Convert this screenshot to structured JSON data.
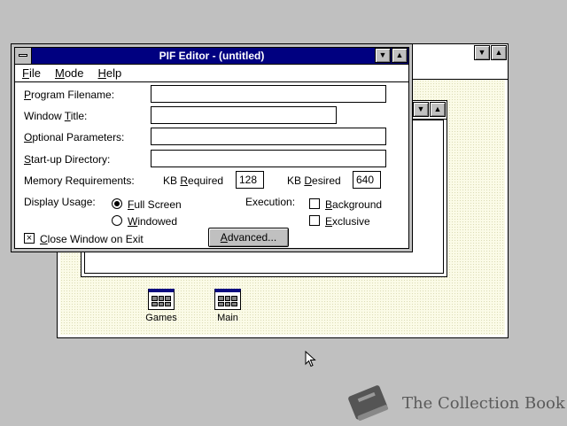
{
  "pif_editor": {
    "title": "PIF Editor - (untitled)",
    "menu": [
      {
        "key": "F",
        "rest": "ile"
      },
      {
        "key": "M",
        "rest": "ode"
      },
      {
        "key": "H",
        "rest": "elp"
      }
    ],
    "program_filename": {
      "key": "P",
      "rest": "rogram Filename:",
      "value": ""
    },
    "window_title": {
      "pre": "Window ",
      "key": "T",
      "rest": "itle:",
      "value": ""
    },
    "optional_parameters": {
      "key": "O",
      "rest": "ptional Parameters:",
      "value": ""
    },
    "startup_directory": {
      "key": "S",
      "rest": "tart-up Directory:",
      "value": ""
    },
    "memory": {
      "label": "Memory Requirements:",
      "kb_required": {
        "pre": "KB ",
        "key": "R",
        "rest": "equired",
        "value": "128"
      },
      "kb_desired": {
        "pre": "KB ",
        "key": "D",
        "rest": "esired",
        "value": "640"
      }
    },
    "display_usage": {
      "label": "Display Usage:",
      "full_screen": {
        "key": "F",
        "rest": "ull Screen",
        "selected": true
      },
      "windowed": {
        "key": "W",
        "rest": "indowed",
        "selected": false
      }
    },
    "execution": {
      "label": "Execution:",
      "background": {
        "key": "B",
        "rest": "ackground",
        "checked": false
      },
      "exclusive": {
        "key": "E",
        "rest": "xclusive",
        "checked": false
      }
    },
    "close_on_exit": {
      "key": "C",
      "rest": "lose Window on Exit",
      "checked": true,
      "mark": "×"
    },
    "advanced_button": {
      "key": "A",
      "rest": "dvanced..."
    }
  },
  "desktop": {
    "groups": [
      {
        "label": "Games"
      },
      {
        "label": "Main"
      }
    ]
  },
  "watermark": {
    "text": "The Collection Book"
  }
}
